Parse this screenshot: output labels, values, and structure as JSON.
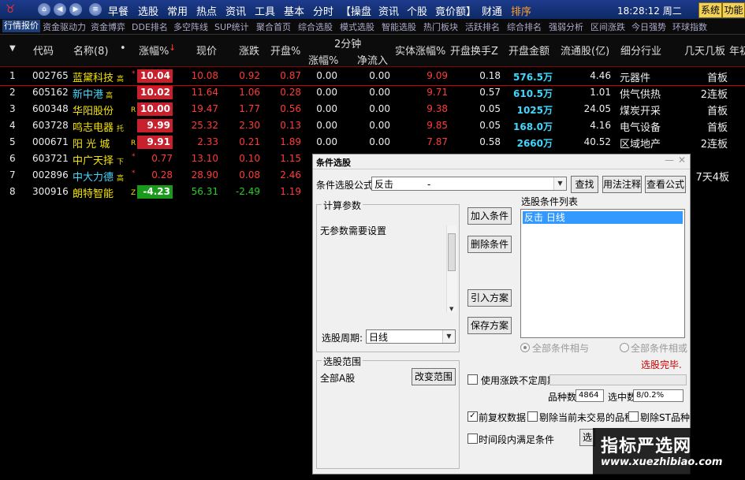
{
  "menubar": {
    "items": [
      "早餐",
      "选股",
      "常用",
      "热点",
      "资讯",
      "工具",
      "基本",
      "分时",
      "【操盘",
      "资讯",
      "个股",
      "竟价额】",
      "财通",
      "排序"
    ],
    "clock": "18:28:12 周二",
    "system_btn": "系统",
    "function_btn": "功能"
  },
  "tabs": [
    "行情报价",
    "资金驱动力",
    "资金博弈",
    "DDE排名",
    "多空阵线",
    "SUP统计",
    "聚合首页",
    "综合选股",
    "模式选股",
    "智能选股",
    "热门板块",
    "活跃排名",
    "综合排名",
    "强弱分析",
    "区间涨跌",
    "今日强势",
    "环球指数"
  ],
  "table": {
    "headers": {
      "code": "代码",
      "name": "名称(8)",
      "dot": "•",
      "change_pct": "涨幅%",
      "sort_arrow": "↓",
      "price": "现价",
      "change": "涨跌",
      "open_pct": "开盘%",
      "two_min": "2分钟",
      "two_min_pct": "涨幅%",
      "two_min_inflow": "净流入",
      "body_pct": "实体涨幅%",
      "open_turnover": "开盘换手Z",
      "open_amount": "开盘金额",
      "float_cap": "流通股(亿)",
      "industry": "细分行业",
      "limit_days": "几天几板",
      "year": "年初"
    },
    "rows": [
      {
        "idx": "1",
        "code": "002765",
        "name": "蓝黛科技",
        "flag": "高",
        "mark": "*",
        "change_pct": "10.04",
        "price": "10.08",
        "change": "0.92",
        "open_pct": "0.87",
        "m2_pct": "0.00",
        "m2_inflow": "0.00",
        "body_pct": "9.09",
        "turnover": "0.18",
        "amount": "576.5万",
        "float_cap": "4.46",
        "industry": "元器件",
        "limit": "首板"
      },
      {
        "idx": "2",
        "code": "605162",
        "name": "新中港",
        "flag": "高",
        "mark": "",
        "change_pct": "10.02",
        "price": "11.64",
        "change": "1.06",
        "open_pct": "0.28",
        "m2_pct": "0.00",
        "m2_inflow": "0.00",
        "body_pct": "9.71",
        "turnover": "0.57",
        "amount": "610.5万",
        "float_cap": "1.01",
        "industry": "供气供热",
        "limit": "2连板"
      },
      {
        "idx": "3",
        "code": "600348",
        "name": "华阳股份",
        "flag": "R",
        "mark": "",
        "change_pct": "10.00",
        "price": "19.47",
        "change": "1.77",
        "open_pct": "0.56",
        "m2_pct": "0.00",
        "m2_inflow": "0.00",
        "body_pct": "9.38",
        "turnover": "0.05",
        "amount": "1025万",
        "float_cap": "24.05",
        "industry": "煤炭开采",
        "limit": "首板"
      },
      {
        "idx": "4",
        "code": "603728",
        "name": "鸣志电器",
        "flag": "托",
        "mark": "",
        "change_pct": "9.99",
        "price": "25.32",
        "change": "2.30",
        "open_pct": "0.13",
        "m2_pct": "0.00",
        "m2_inflow": "0.00",
        "body_pct": "9.85",
        "turnover": "0.05",
        "amount": "168.0万",
        "float_cap": "4.16",
        "industry": "电气设备",
        "limit": "首板"
      },
      {
        "idx": "5",
        "code": "000671",
        "name": "阳 光 城",
        "flag": "R",
        "mark": "",
        "change_pct": "9.91",
        "price": "2.33",
        "change": "0.21",
        "open_pct": "1.89",
        "m2_pct": "0.00",
        "m2_inflow": "0.00",
        "body_pct": "7.87",
        "turnover": "0.58",
        "amount": "2660万",
        "float_cap": "40.52",
        "industry": "区域地产",
        "limit": "2连板"
      },
      {
        "idx": "6",
        "code": "603721",
        "name": "中广天择",
        "flag": "下",
        "mark": "*",
        "change_pct": "0.77",
        "price": "13.10",
        "change": "0.10",
        "open_pct": "1.15"
      },
      {
        "idx": "7",
        "code": "002896",
        "name": "中大力德",
        "flag": "高",
        "mark": "*",
        "change_pct": "0.28",
        "price": "28.90",
        "change": "0.08",
        "open_pct": "2.46",
        "limit": "7天4板"
      },
      {
        "idx": "8",
        "code": "300916",
        "name": "朗特智能",
        "flag": "Z",
        "mark": "",
        "change_pct": "-4.23",
        "price": "56.31",
        "change": "-2.49",
        "open_pct": "1.19"
      }
    ]
  },
  "dialog": {
    "title": "条件选股",
    "formula_label": "条件选股公式",
    "formula_value": "反击",
    "formula_dash": "-",
    "find_btn": "查找",
    "usage_btn": "用法注释",
    "view_btn": "查看公式",
    "params_title": "计算参数",
    "params_text": "无参数需要设置",
    "period_label": "选股周期:",
    "period_value": "日线",
    "range_title": "选股范围",
    "range_value": "全部A股",
    "change_range_btn": "改变范围",
    "add_btn": "加入条件",
    "delete_btn": "删除条件",
    "import_btn": "引入方案",
    "save_btn": "保存方案",
    "list_title": "选股条件列表",
    "list_items": [
      "反击  日线"
    ],
    "radio_and": "全部条件相与",
    "radio_or": "全部条件相或",
    "status": "选股完毕.",
    "use_period_label": "使用涨跌不定周期",
    "count_label": "品种数",
    "count_value": "4864",
    "selected_label": "选中数",
    "selected_value": "8/0.2%",
    "adjust_label": "前复权数据",
    "exclude_untraded": "剔除当前未交易的品种",
    "exclude_st": "剔除ST品种",
    "time_period_label": "时间段内满足条件",
    "partial_btn": "选"
  },
  "watermark": {
    "cn": "指标严选网",
    "en": "www.xuezhibiao.com"
  }
}
